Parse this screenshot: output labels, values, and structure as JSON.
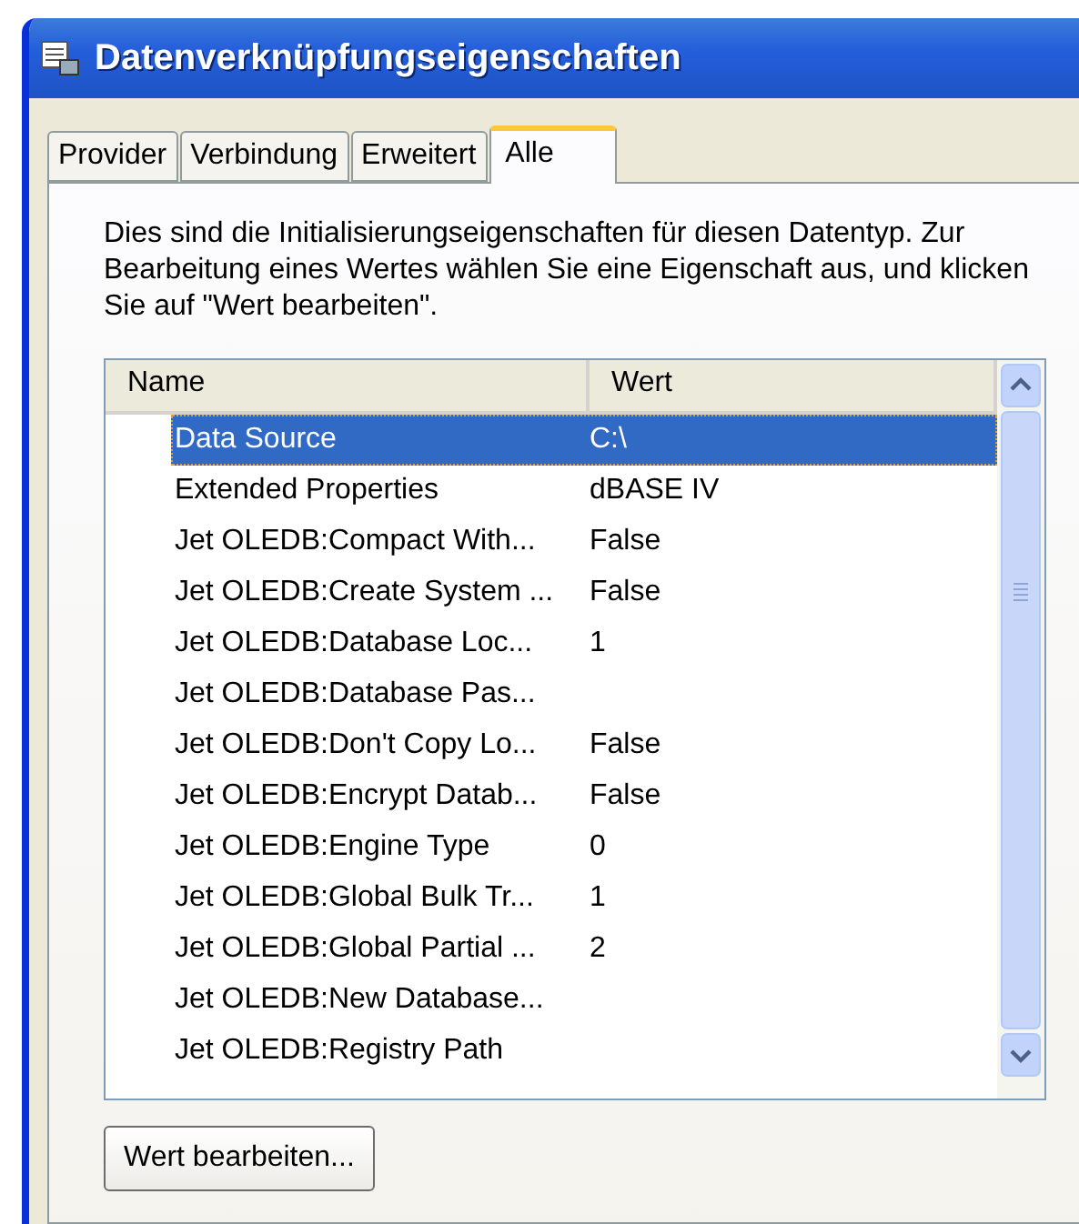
{
  "window": {
    "title": "Datenverknüpfungseigenschaften"
  },
  "tabs": [
    {
      "label": "Provider",
      "selected": false
    },
    {
      "label": "Verbindung",
      "selected": false
    },
    {
      "label": "Erweitert",
      "selected": false
    },
    {
      "label": "Alle",
      "selected": true
    }
  ],
  "description": "Dies sind die Initialisierungseigenschaften für diesen Datentyp. Zur Bearbeitung eines Wertes wählen Sie eine Eigenschaft aus, und klicken Sie auf \"Wert bearbeiten\".",
  "table": {
    "columns": [
      "Name",
      "Wert"
    ],
    "rows": [
      {
        "name": "Data Source",
        "value": "C:\\",
        "selected": true
      },
      {
        "name": "Extended Properties",
        "value": "dBASE IV",
        "selected": false
      },
      {
        "name": "Jet OLEDB:Compact With...",
        "value": "False",
        "selected": false
      },
      {
        "name": "Jet OLEDB:Create System ...",
        "value": "False",
        "selected": false
      },
      {
        "name": "Jet OLEDB:Database Loc...",
        "value": "1",
        "selected": false
      },
      {
        "name": "Jet OLEDB:Database Pas...",
        "selected": false
      },
      {
        "name": "Jet OLEDB:Don't Copy Lo...",
        "value": "False",
        "selected": false
      },
      {
        "name": "Jet OLEDB:Encrypt Datab...",
        "value": "False",
        "selected": false
      },
      {
        "name": "Jet OLEDB:Engine Type",
        "value": "0",
        "selected": false
      },
      {
        "name": "Jet OLEDB:Global Bulk Tr...",
        "value": "1",
        "selected": false
      },
      {
        "name": "Jet OLEDB:Global Partial ...",
        "value": "2",
        "selected": false
      },
      {
        "name": "Jet OLEDB:New Database...",
        "selected": false
      },
      {
        "name": "Jet OLEDB:Registry Path",
        "selected": false
      }
    ]
  },
  "buttons": [
    "Wert bearbeiten..."
  ]
}
